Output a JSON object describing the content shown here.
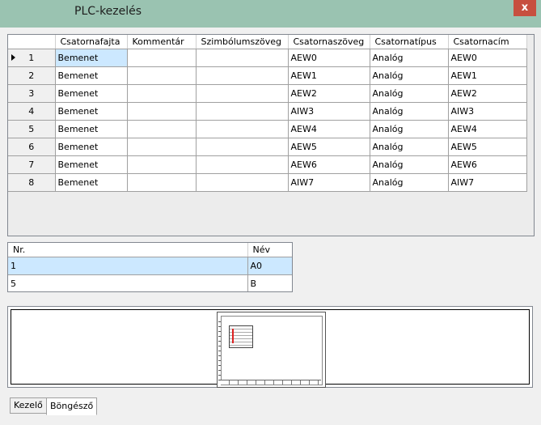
{
  "window": {
    "title": "PLC-kezelés",
    "close_label": "x"
  },
  "grid": {
    "columns": [
      "Csatornafajta",
      "Kommentár",
      "Szimbólumszöveg",
      "Csatornaszöveg",
      "Csatornatípus",
      "Csatornacím"
    ],
    "rows": [
      {
        "nr": "1",
        "cells": [
          "Bemenet",
          "",
          "",
          "AEW0",
          "Analóg",
          "AEW0"
        ]
      },
      {
        "nr": "2",
        "cells": [
          "Bemenet",
          "",
          "",
          "AEW1",
          "Analóg",
          "AEW1"
        ]
      },
      {
        "nr": "3",
        "cells": [
          "Bemenet",
          "",
          "",
          "AEW2",
          "Analóg",
          "AEW2"
        ]
      },
      {
        "nr": "4",
        "cells": [
          "Bemenet",
          "",
          "",
          "AIW3",
          "Analóg",
          "AIW3"
        ]
      },
      {
        "nr": "5",
        "cells": [
          "Bemenet",
          "",
          "",
          "AEW4",
          "Analóg",
          "AEW4"
        ]
      },
      {
        "nr": "6",
        "cells": [
          "Bemenet",
          "",
          "",
          "AEW5",
          "Analóg",
          "AEW5"
        ]
      },
      {
        "nr": "7",
        "cells": [
          "Bemenet",
          "",
          "",
          "AEW6",
          "Analóg",
          "AEW6"
        ]
      },
      {
        "nr": "8",
        "cells": [
          "Bemenet",
          "",
          "",
          "AIW7",
          "Analóg",
          "AIW7"
        ]
      }
    ]
  },
  "grid2": {
    "columns": [
      "Nr.",
      "Név"
    ],
    "rows": [
      {
        "nr": "1",
        "name": "A0"
      },
      {
        "nr": "5",
        "name": "B"
      }
    ]
  },
  "tabs": [
    "Kezelő",
    "Böngésző"
  ],
  "colors": {
    "titlebar": "#9ac3b1",
    "selection": "#cce8ff",
    "close": "#c74f3f"
  }
}
